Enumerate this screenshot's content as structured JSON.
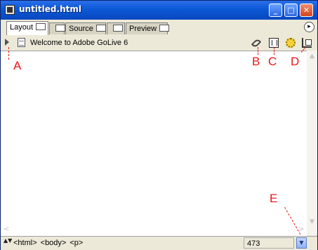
{
  "window": {
    "title": "untitled.html",
    "minimize_glyph": "_",
    "maximize_glyph": "□",
    "close_glyph": "✕"
  },
  "tabs": [
    {
      "label": "Layout",
      "active": true
    },
    {
      "label": "",
      "active": false
    },
    {
      "label": "Source",
      "active": false
    },
    {
      "label": "",
      "active": false
    },
    {
      "label": "Preview",
      "active": false
    }
  ],
  "tab_menu_glyph": "▸",
  "toolbar": {
    "page_title": "Welcome to Adobe GoLive 6",
    "icons": [
      "link-icon",
      "frame-icon",
      "gear-icon",
      "layout-icon"
    ]
  },
  "callouts": {
    "a": "A",
    "b": "B",
    "c": "C",
    "d": "D",
    "e": "E"
  },
  "scroll": {
    "up": "▲",
    "down": "▼",
    "left": "<",
    "right": ">"
  },
  "statusbar": {
    "stepper": "▲▼",
    "tags": [
      "<html>",
      "<body>",
      "<p>"
    ],
    "window_width": "473",
    "dropdown_glyph": "▼"
  },
  "colors": {
    "title_bar": "#0b58d6",
    "callout": "#e8171b",
    "window_bg": "#ece9d8"
  }
}
